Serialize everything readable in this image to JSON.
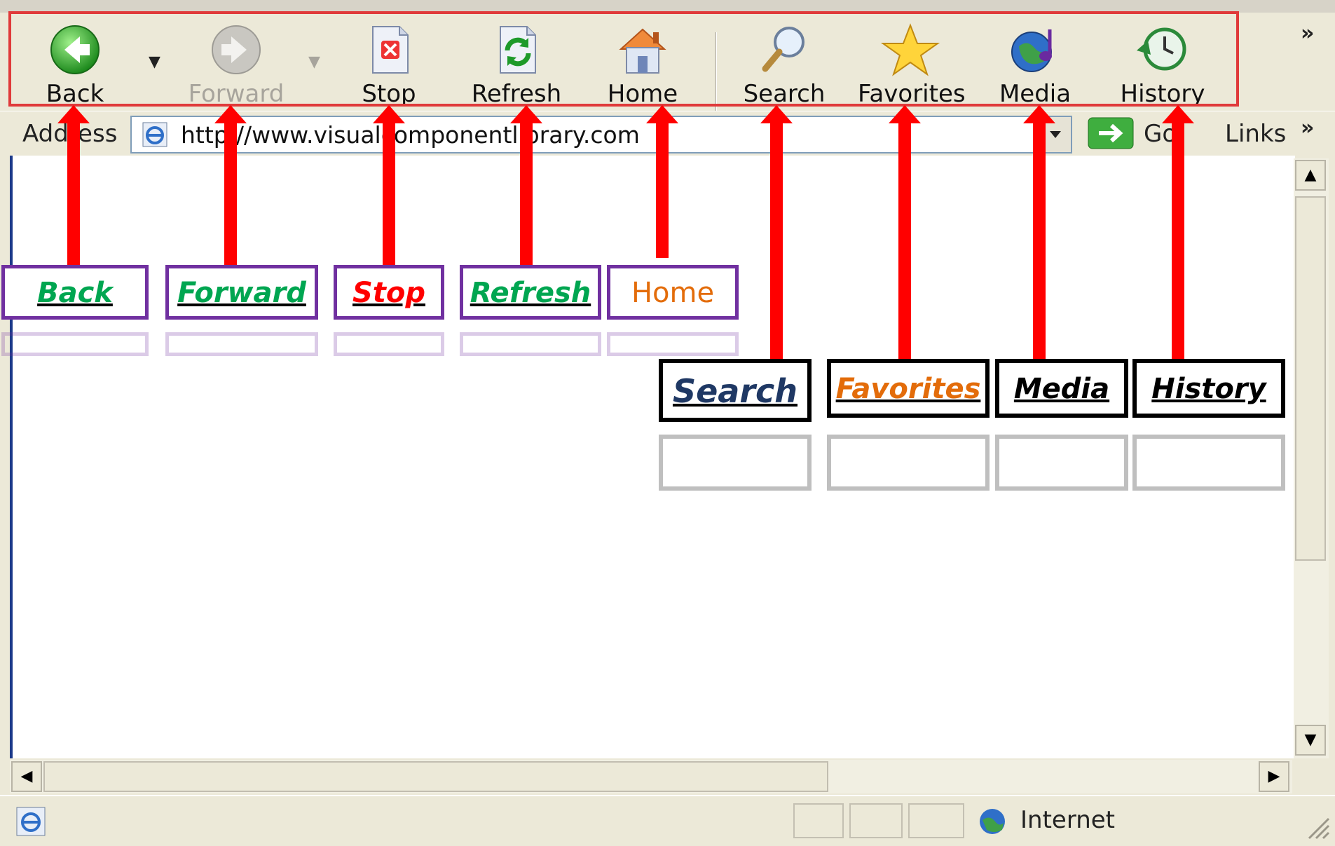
{
  "toolbar": {
    "buttons": [
      {
        "label": "Back",
        "icon": "back-arrow-icon",
        "enabled": true
      },
      {
        "label": "Forward",
        "icon": "forward-arrow-icon",
        "enabled": false
      },
      {
        "label": "Stop",
        "icon": "stop-icon",
        "enabled": true
      },
      {
        "label": "Refresh",
        "icon": "refresh-icon",
        "enabled": true
      },
      {
        "label": "Home",
        "icon": "home-icon",
        "enabled": true
      },
      {
        "label": "Search",
        "icon": "search-icon",
        "enabled": true
      },
      {
        "label": "Favorites",
        "icon": "star-icon",
        "enabled": true
      },
      {
        "label": "Media",
        "icon": "media-icon",
        "enabled": true
      },
      {
        "label": "History",
        "icon": "history-icon",
        "enabled": true
      }
    ],
    "overflow": "»",
    "highlight_color": "#e03a3a"
  },
  "address_bar": {
    "label": "Address",
    "url": "http://www.visualcomponentlibrary.com",
    "go_label": "Go",
    "links_label": "Links",
    "overflow": "»"
  },
  "callouts": [
    {
      "label": "Back",
      "color": "#00a651",
      "style": "purple"
    },
    {
      "label": "Forward",
      "color": "#00a651",
      "style": "purple"
    },
    {
      "label": "Stop",
      "color": "#ff0000",
      "style": "purple"
    },
    {
      "label": "Refresh",
      "color": "#00a651",
      "style": "purple"
    },
    {
      "label": "Home",
      "color": "#e36c0a",
      "style": "purple-plain"
    },
    {
      "label": "Search",
      "color": "#1f3864",
      "style": "black"
    },
    {
      "label": "Favorites",
      "color": "#e36c0a",
      "style": "black"
    },
    {
      "label": "Media",
      "color": "#000000",
      "style": "black"
    },
    {
      "label": "History",
      "color": "#000000",
      "style": "black"
    }
  ],
  "status_bar": {
    "zone": "Internet"
  }
}
